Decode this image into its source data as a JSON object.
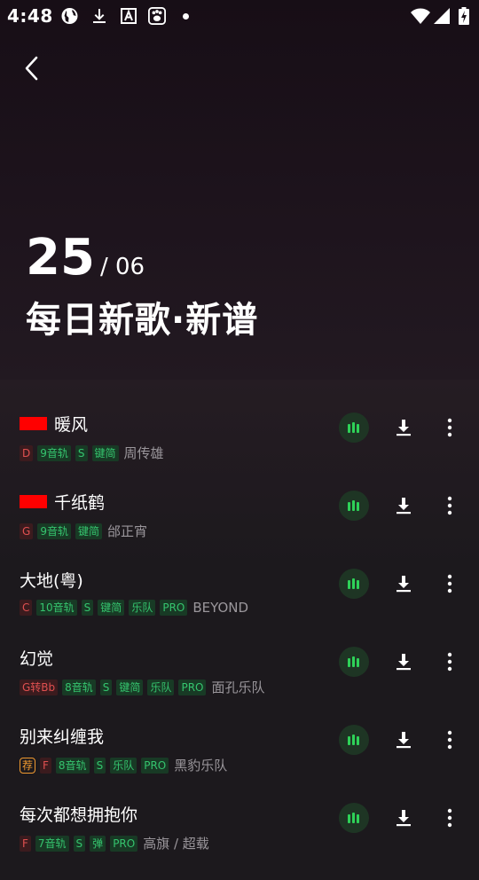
{
  "status": {
    "time": "4:48",
    "icons": [
      "globe-icon",
      "download-icon",
      "text-a-icon",
      "paw-icon",
      "notification-dot",
      "wifi-icon",
      "signal-icon",
      "battery-charging-icon"
    ]
  },
  "header": {
    "back_icon": "chevron-left-icon",
    "day": "25",
    "month": "/ 06",
    "title": "每日新歌·新谱"
  },
  "songs": [
    {
      "title": "暖风",
      "red_marker": true,
      "tags": [
        {
          "text": "D",
          "style": "key"
        },
        {
          "text": "9音轨",
          "style": "green"
        },
        {
          "text": "S",
          "style": "green"
        },
        {
          "text": "键简",
          "style": "green"
        }
      ],
      "artist": "周传雄"
    },
    {
      "title": "千纸鹤",
      "red_marker": true,
      "tags": [
        {
          "text": "G",
          "style": "key"
        },
        {
          "text": "9音轨",
          "style": "green"
        },
        {
          "text": "键简",
          "style": "green"
        }
      ],
      "artist": "邰正宵"
    },
    {
      "title": "大地(粤)",
      "red_marker": false,
      "tags": [
        {
          "text": "C",
          "style": "key"
        },
        {
          "text": "10音轨",
          "style": "green"
        },
        {
          "text": "S",
          "style": "green"
        },
        {
          "text": "键简",
          "style": "green"
        },
        {
          "text": "乐队",
          "style": "green"
        },
        {
          "text": "PRO",
          "style": "green"
        }
      ],
      "artist": "BEYOND"
    },
    {
      "title": "幻觉",
      "red_marker": false,
      "tags": [
        {
          "text": "G转Bb",
          "style": "key"
        },
        {
          "text": "8音轨",
          "style": "green"
        },
        {
          "text": "S",
          "style": "green"
        },
        {
          "text": "键简",
          "style": "green"
        },
        {
          "text": "乐队",
          "style": "green"
        },
        {
          "text": "PRO",
          "style": "green"
        }
      ],
      "artist": "面孔乐队"
    },
    {
      "title": "别来纠缠我",
      "red_marker": false,
      "tags": [
        {
          "text": "荐",
          "style": "orange"
        },
        {
          "text": "F",
          "style": "key"
        },
        {
          "text": "8音轨",
          "style": "green"
        },
        {
          "text": "S",
          "style": "green"
        },
        {
          "text": "乐队",
          "style": "green"
        },
        {
          "text": "PRO",
          "style": "green"
        }
      ],
      "artist": "黑豹乐队"
    },
    {
      "title": "每次都想拥抱你",
      "red_marker": false,
      "tags": [
        {
          "text": "F",
          "style": "key"
        },
        {
          "text": "7音轨",
          "style": "green"
        },
        {
          "text": "S",
          "style": "green"
        },
        {
          "text": "弹",
          "style": "green"
        },
        {
          "text": "PRO",
          "style": "green"
        }
      ],
      "artist": "高旗 / 超载"
    }
  ],
  "row_icons": {
    "play": "equalizer-play-icon",
    "download": "download-icon",
    "more": "more-vertical-icon"
  },
  "colors": {
    "accent_green": "#2ed158",
    "key_red": "#e05050",
    "marker_red": "#ff0000",
    "recommend_orange": "#f09a30"
  }
}
